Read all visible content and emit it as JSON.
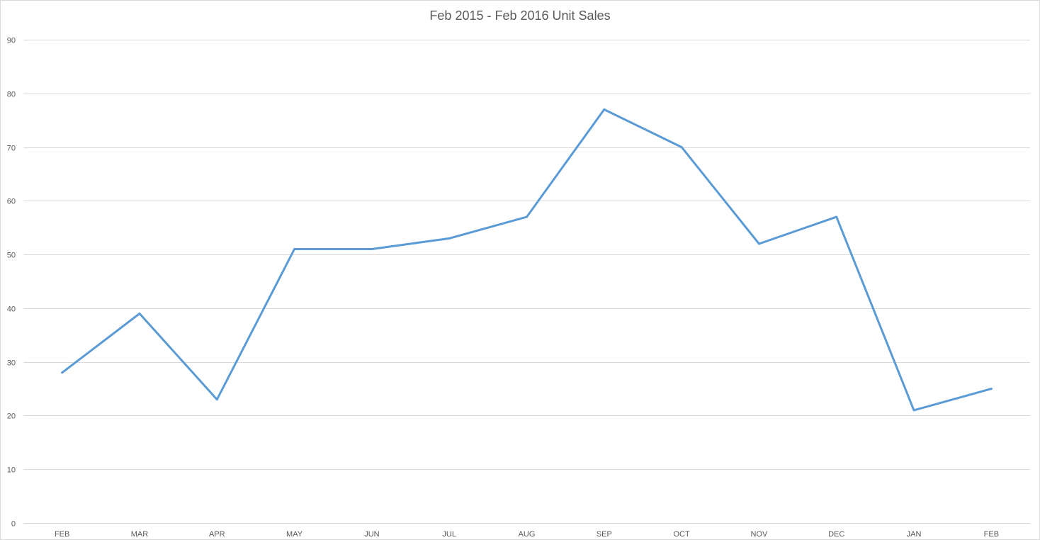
{
  "chart_data": {
    "type": "line",
    "title": "Feb 2015 - Feb 2016 Unit Sales",
    "xlabel": "",
    "ylabel": "",
    "categories": [
      "FEB",
      "MAR",
      "APR",
      "MAY",
      "JUN",
      "JUL",
      "AUG",
      "SEP",
      "OCT",
      "NOV",
      "DEC",
      "JAN",
      "FEB"
    ],
    "series": [
      {
        "values": [
          28,
          39,
          23,
          51,
          51,
          53,
          57,
          77,
          70,
          52,
          57,
          21,
          25
        ],
        "color": "#5b9bd5"
      }
    ],
    "ylim": [
      0,
      90
    ],
    "yticks": [
      0,
      10,
      20,
      30,
      40,
      50,
      60,
      70,
      80,
      90
    ],
    "grid": "horizontal",
    "legend": "none"
  }
}
